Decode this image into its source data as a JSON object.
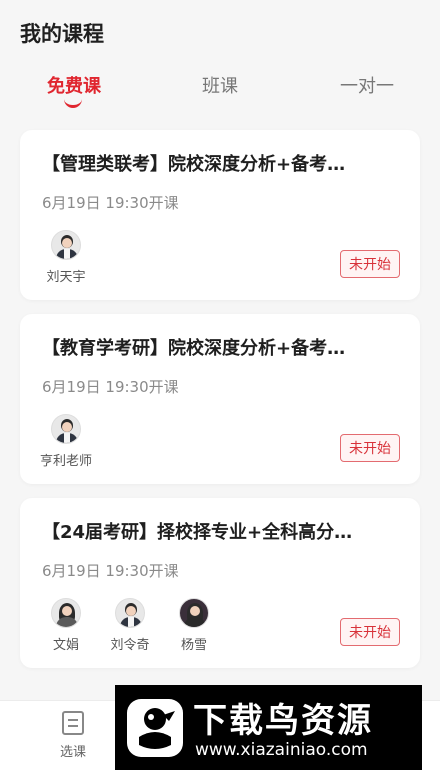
{
  "header": {
    "title": "我的课程"
  },
  "tabs": [
    {
      "label": "免费课",
      "active": true
    },
    {
      "label": "班课",
      "active": false
    },
    {
      "label": "一对一",
      "active": false
    }
  ],
  "courses": [
    {
      "title": "【管理类联考】院校深度分析+备考…",
      "time": "6月19日 19:30开课",
      "teachers": [
        "刘天宇"
      ],
      "status": "未开始"
    },
    {
      "title": "【教育学考研】院校深度分析+备考…",
      "time": "6月19日 19:30开课",
      "teachers": [
        "亨利老师"
      ],
      "status": "未开始"
    },
    {
      "title": "【24届考研】择校择专业+全科高分…",
      "time": "6月19日 19:30开课",
      "teachers": [
        "文娟",
        "刘令奇",
        "杨雪"
      ],
      "status": "未开始"
    }
  ],
  "bottom_nav": {
    "items": [
      {
        "label": "选课",
        "icon": "course-list-icon"
      }
    ]
  },
  "watermark": {
    "text": "下载鸟资源",
    "url": "www.xiazainiao.com"
  },
  "colors": {
    "accent": "#e0262f",
    "background": "#f6f6f6",
    "card": "#ffffff"
  }
}
